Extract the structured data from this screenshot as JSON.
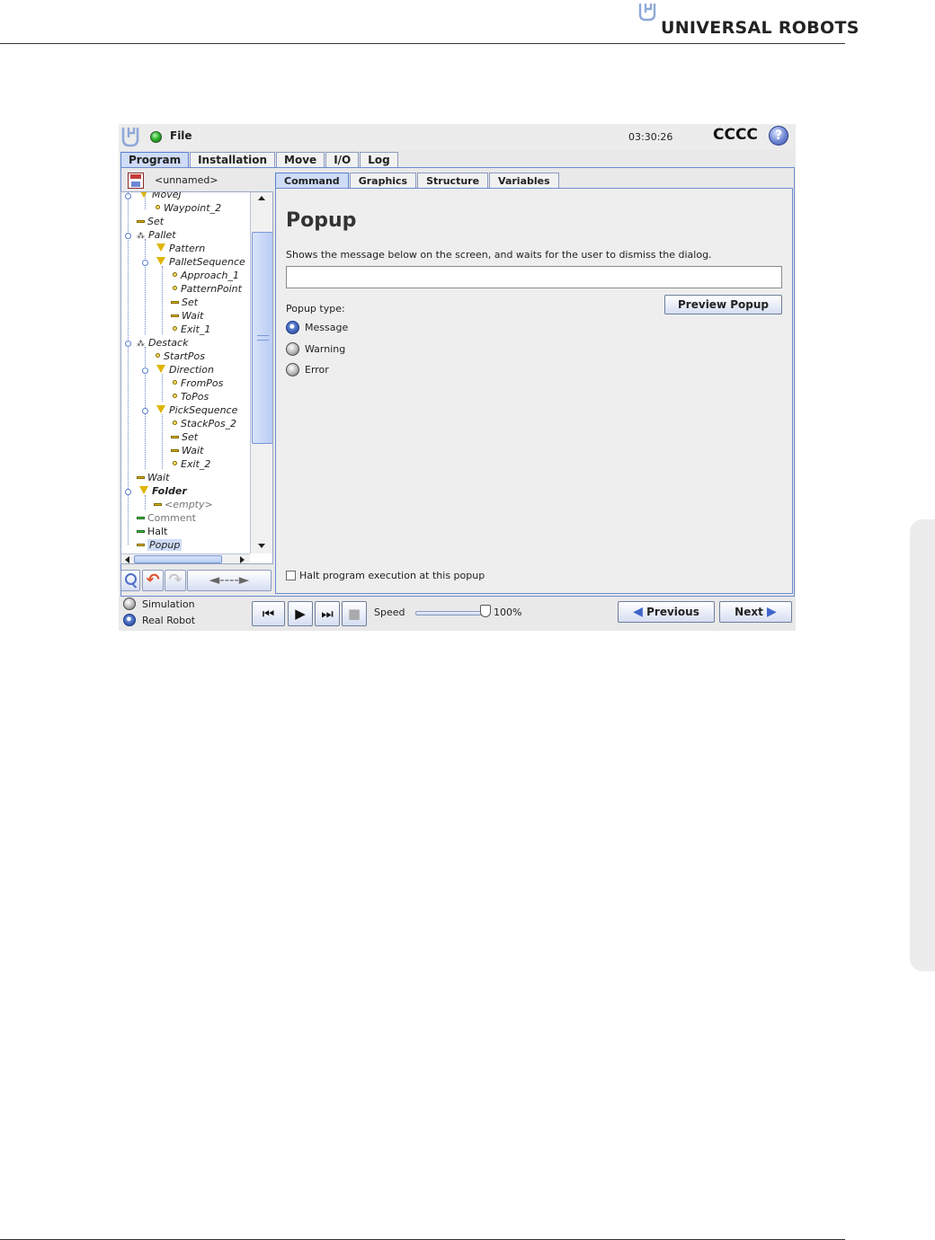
{
  "page": {
    "brand": "UNIVERSAL ROBOTS"
  },
  "app": {
    "menu_label": "File",
    "time": "03:30:26",
    "robot_name": "CCCC",
    "help_glyph": "?",
    "status_color": "#2fb52f",
    "main_tabs": [
      {
        "label": "Program",
        "active": true
      },
      {
        "label": "Installation",
        "active": false
      },
      {
        "label": "Move",
        "active": false
      },
      {
        "label": "I/O",
        "active": false
      },
      {
        "label": "Log",
        "active": false
      }
    ],
    "program_name": "<unnamed>",
    "tree": [
      {
        "label": "MoveJ",
        "icon": "folder-triangle-icon"
      },
      {
        "label": "Waypoint_2",
        "icon": "waypoint-icon"
      },
      {
        "label": "Set",
        "icon": "command-bar-icon"
      },
      {
        "label": "Pallet",
        "icon": "pallet-icon"
      },
      {
        "label": "Pattern",
        "icon": "folder-triangle-icon"
      },
      {
        "label": "PalletSequence",
        "icon": "folder-triangle-icon"
      },
      {
        "label": "Approach_1",
        "icon": "waypoint-icon"
      },
      {
        "label": "PatternPoint",
        "icon": "waypoint-icon"
      },
      {
        "label": "Set",
        "icon": "command-bar-icon"
      },
      {
        "label": "Wait",
        "icon": "command-bar-icon"
      },
      {
        "label": "Exit_1",
        "icon": "waypoint-icon"
      },
      {
        "label": "Destack",
        "icon": "pallet-icon"
      },
      {
        "label": "StartPos",
        "icon": "waypoint-icon"
      },
      {
        "label": "Direction",
        "icon": "folder-triangle-icon"
      },
      {
        "label": "FromPos",
        "icon": "waypoint-icon"
      },
      {
        "label": "ToPos",
        "icon": "waypoint-icon"
      },
      {
        "label": "PickSequence",
        "icon": "folder-triangle-icon"
      },
      {
        "label": "StackPos_2",
        "icon": "waypoint-icon"
      },
      {
        "label": "Set",
        "icon": "command-bar-icon"
      },
      {
        "label": "Wait",
        "icon": "command-bar-icon"
      },
      {
        "label": "Exit_2",
        "icon": "waypoint-icon"
      },
      {
        "label": "Wait",
        "icon": "command-bar-icon"
      },
      {
        "label": "Folder",
        "icon": "folder-triangle-icon"
      },
      {
        "label": "<empty>",
        "icon": "command-bar-icon"
      },
      {
        "label": "Comment",
        "icon": "green-bar-icon"
      },
      {
        "label": "Halt",
        "icon": "green-bar-icon"
      },
      {
        "label": "Popup",
        "icon": "command-bar-icon",
        "selected": true
      }
    ],
    "tree_toolbar": {
      "move_label": "◄----►"
    },
    "sub_tabs": [
      {
        "label": "Command",
        "active": true
      },
      {
        "label": "Graphics",
        "active": false
      },
      {
        "label": "Structure",
        "active": false
      },
      {
        "label": "Variables",
        "active": false
      }
    ],
    "command": {
      "title": "Popup",
      "description": "Shows the message below on the screen, and waits for the user to dismiss the dialog.",
      "message_value": "",
      "preview_button": "Preview Popup",
      "type_label": "Popup type:",
      "types": [
        {
          "label": "Message",
          "checked": true
        },
        {
          "label": "Warning",
          "checked": false
        },
        {
          "label": "Error",
          "checked": false
        }
      ],
      "halt_label": "Halt program execution at this popup",
      "halt_checked": false
    },
    "bottom": {
      "modes": [
        {
          "label": "Simulation",
          "active": false
        },
        {
          "label": "Real Robot",
          "active": true
        }
      ],
      "speed_label": "Speed",
      "speed_value": "100%",
      "speed_fraction": 1.0,
      "previous_label": "Previous",
      "next_label": "Next"
    }
  }
}
